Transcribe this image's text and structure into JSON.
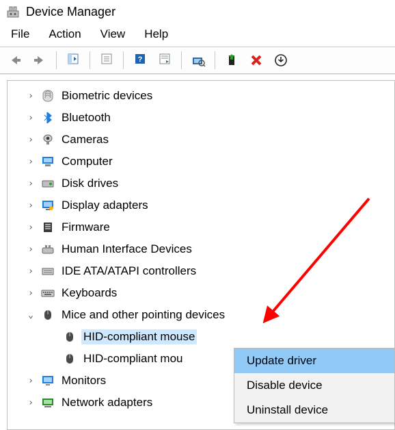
{
  "title": "Device Manager",
  "menu": {
    "file": "File",
    "action": "Action",
    "view": "View",
    "help": "Help"
  },
  "tree": [
    {
      "icon": "biometric",
      "label": "Biometric devices",
      "expanded": false
    },
    {
      "icon": "bluetooth",
      "label": "Bluetooth",
      "expanded": false
    },
    {
      "icon": "camera",
      "label": "Cameras",
      "expanded": false
    },
    {
      "icon": "computer",
      "label": "Computer",
      "expanded": false
    },
    {
      "icon": "disk",
      "label": "Disk drives",
      "expanded": false
    },
    {
      "icon": "display",
      "label": "Display adapters",
      "expanded": false
    },
    {
      "icon": "firmware",
      "label": "Firmware",
      "expanded": false
    },
    {
      "icon": "hid",
      "label": "Human Interface Devices",
      "expanded": false
    },
    {
      "icon": "ide",
      "label": "IDE ATA/ATAPI controllers",
      "expanded": false
    },
    {
      "icon": "keyboard",
      "label": "Keyboards",
      "expanded": false
    },
    {
      "icon": "mouse",
      "label": "Mice and other pointing devices",
      "expanded": true,
      "children": [
        {
          "icon": "mouse",
          "label": "HID-compliant mouse",
          "selected": true
        },
        {
          "icon": "mouse",
          "label": "HID-compliant mou"
        }
      ]
    },
    {
      "icon": "monitor",
      "label": "Monitors",
      "expanded": false
    },
    {
      "icon": "network",
      "label": "Network adapters",
      "expanded": false
    }
  ],
  "context_menu": {
    "items": [
      {
        "label": "Update driver",
        "highlight": true
      },
      {
        "label": "Disable device",
        "highlight": false
      },
      {
        "label": "Uninstall device",
        "highlight": false
      }
    ]
  },
  "twist": {
    "right": ">",
    "down": "v"
  }
}
